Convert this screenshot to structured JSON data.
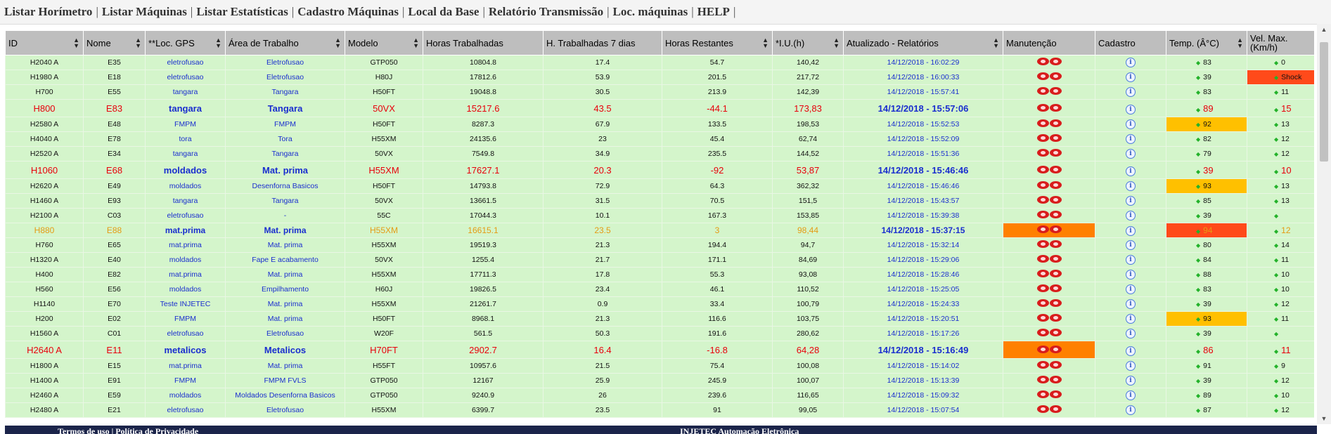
{
  "nav": [
    "Listar Horímetro",
    "Listar Máquinas",
    "Listar Estatísticas",
    "Cadastro Máquinas",
    "Local da Base",
    "Relatório Transmissão",
    "Loc. máquinas",
    "HELP"
  ],
  "columns": [
    "ID",
    "Nome",
    "**Loc. GPS",
    "Área de Trabalho",
    "Modelo",
    "Horas Trabalhadas",
    "H. Trabalhadas 7 dias",
    "Horas Restantes",
    "*I.U.(h)",
    "Atualizado - Relatórios",
    "Manutenção",
    "Cadastro",
    "Temp. (Â°C)",
    "Vel. Max.(Km/h)"
  ],
  "rows": [
    {
      "id": "H2040 A",
      "nome": "E35",
      "gps": "eletrofusao",
      "area": "Eletrofusao",
      "modelo": "GTP050",
      "horas": "10804.8",
      "h7": "17.4",
      "rest": "54.7",
      "iu": "140,42",
      "atual": "14/12/2018 - 16:02:29",
      "temp": "83",
      "vel": "0",
      "style": ""
    },
    {
      "id": "H1980 A",
      "nome": "E18",
      "gps": "eletrofusao",
      "area": "Eletrofusao",
      "modelo": "H80J",
      "horas": "17812.6",
      "h7": "53.9",
      "rest": "201.5",
      "iu": "217,72",
      "atual": "14/12/2018 - 16:00:33",
      "temp": "39",
      "vel": "Shock",
      "style": "",
      "velHl": "red"
    },
    {
      "id": "H700",
      "nome": "E55",
      "gps": "tangara",
      "area": "Tangara",
      "modelo": "H50FT",
      "horas": "19048.8",
      "h7": "30.5",
      "rest": "213.9",
      "iu": "142,39",
      "atual": "14/12/2018 - 15:57:41",
      "temp": "83",
      "vel": "11",
      "style": ""
    },
    {
      "id": "H800",
      "nome": "E83",
      "gps": "tangara",
      "area": "Tangara",
      "modelo": "50VX",
      "horas": "15217.6",
      "h7": "43.5",
      "rest": "-44.1",
      "iu": "173,83",
      "atual": "14/12/2018 - 15:57:06",
      "temp": "89",
      "vel": "15",
      "style": "alert"
    },
    {
      "id": "H2580 A",
      "nome": "E48",
      "gps": "FMPM",
      "area": "FMPM",
      "modelo": "H50FT",
      "horas": "8287.3",
      "h7": "67.9",
      "rest": "133.5",
      "iu": "198,53",
      "atual": "14/12/2018 - 15:52:53",
      "temp": "92",
      "vel": "13",
      "style": "",
      "tempHl": "yellow"
    },
    {
      "id": "H4040 A",
      "nome": "E78",
      "gps": "tora",
      "area": "Tora",
      "modelo": "H55XM",
      "horas": "24135.6",
      "h7": "23",
      "rest": "45.4",
      "iu": "62,74",
      "atual": "14/12/2018 - 15:52:09",
      "temp": "82",
      "vel": "12",
      "style": ""
    },
    {
      "id": "H2520 A",
      "nome": "E34",
      "gps": "tangara",
      "area": "Tangara",
      "modelo": "50VX",
      "horas": "7549.8",
      "h7": "34.9",
      "rest": "235.5",
      "iu": "144,52",
      "atual": "14/12/2018 - 15:51:36",
      "temp": "79",
      "vel": "12",
      "style": ""
    },
    {
      "id": "H1060",
      "nome": "E68",
      "gps": "moldados",
      "area": "Mat. prima",
      "modelo": "H55XM",
      "horas": "17627.1",
      "h7": "20.3",
      "rest": "-92",
      "iu": "53,87",
      "atual": "14/12/2018 - 15:46:46",
      "temp": "39",
      "vel": "10",
      "style": "alert"
    },
    {
      "id": "H2620 A",
      "nome": "E49",
      "gps": "moldados",
      "area": "Desenforna Basicos",
      "modelo": "H50FT",
      "horas": "14793.8",
      "h7": "72.9",
      "rest": "64.3",
      "iu": "362,32",
      "atual": "14/12/2018 - 15:46:46",
      "temp": "93",
      "vel": "13",
      "style": "",
      "tempHl": "yellow"
    },
    {
      "id": "H1460 A",
      "nome": "E93",
      "gps": "tangara",
      "area": "Tangara",
      "modelo": "50VX",
      "horas": "13661.5",
      "h7": "31.5",
      "rest": "70.5",
      "iu": "151,5",
      "atual": "14/12/2018 - 15:43:57",
      "temp": "85",
      "vel": "13",
      "style": ""
    },
    {
      "id": "H2100 A",
      "nome": "C03",
      "gps": "eletrofusao",
      "area": "-",
      "modelo": "55C",
      "horas": "17044.3",
      "h7": "10.1",
      "rest": "167.3",
      "iu": "153,85",
      "atual": "14/12/2018 - 15:39:38",
      "temp": "39",
      "vel": "",
      "style": ""
    },
    {
      "id": "H880",
      "nome": "E88",
      "gps": "mat.prima",
      "area": "Mat. prima",
      "modelo": "H55XM",
      "horas": "16615.1",
      "h7": "23.5",
      "rest": "3",
      "iu": "98,44",
      "atual": "14/12/2018 - 15:37:15",
      "temp": "94",
      "vel": "12",
      "style": "warn",
      "maintHl": "orange",
      "tempHl": "red"
    },
    {
      "id": "H760",
      "nome": "E65",
      "gps": "mat.prima",
      "area": "Mat. prima",
      "modelo": "H55XM",
      "horas": "19519.3",
      "h7": "21.3",
      "rest": "194.4",
      "iu": "94,7",
      "atual": "14/12/2018 - 15:32:14",
      "temp": "80",
      "vel": "14",
      "style": ""
    },
    {
      "id": "H1320 A",
      "nome": "E40",
      "gps": "moldados",
      "area": "Fape E acabamento",
      "modelo": "50VX",
      "horas": "1255.4",
      "h7": "21.7",
      "rest": "171.1",
      "iu": "84,69",
      "atual": "14/12/2018 - 15:29:06",
      "temp": "84",
      "vel": "11",
      "style": ""
    },
    {
      "id": "H400",
      "nome": "E82",
      "gps": "mat.prima",
      "area": "Mat. prima",
      "modelo": "H55XM",
      "horas": "17711.3",
      "h7": "17.8",
      "rest": "55.3",
      "iu": "93,08",
      "atual": "14/12/2018 - 15:28:46",
      "temp": "88",
      "vel": "10",
      "style": ""
    },
    {
      "id": "H560",
      "nome": "E56",
      "gps": "moldados",
      "area": "Empilhamento",
      "modelo": "H60J",
      "horas": "19826.5",
      "h7": "23.4",
      "rest": "46.1",
      "iu": "110,52",
      "atual": "14/12/2018 - 15:25:05",
      "temp": "83",
      "vel": "10",
      "style": ""
    },
    {
      "id": "H1140",
      "nome": "E70",
      "gps": "Teste INJETEC",
      "area": "Mat. prima",
      "modelo": "H55XM",
      "horas": "21261.7",
      "h7": "0.9",
      "rest": "33.4",
      "iu": "100,79",
      "atual": "14/12/2018 - 15:24:33",
      "temp": "39",
      "vel": "12",
      "style": ""
    },
    {
      "id": "H200",
      "nome": "E02",
      "gps": "FMPM",
      "area": "Mat. prima",
      "modelo": "H50FT",
      "horas": "8968.1",
      "h7": "21.3",
      "rest": "116.6",
      "iu": "103,75",
      "atual": "14/12/2018 - 15:20:51",
      "temp": "93",
      "vel": "11",
      "style": "",
      "tempHl": "yellow"
    },
    {
      "id": "H1560 A",
      "nome": "C01",
      "gps": "eletrofusao",
      "area": "Eletrofusao",
      "modelo": "W20F",
      "horas": "561.5",
      "h7": "50.3",
      "rest": "191.6",
      "iu": "280,62",
      "atual": "14/12/2018 - 15:17:26",
      "temp": "39",
      "vel": "",
      "style": ""
    },
    {
      "id": "H2640 A",
      "nome": "E11",
      "gps": "metalicos",
      "area": "Metalicos",
      "modelo": "H70FT",
      "horas": "2902.7",
      "h7": "16.4",
      "rest": "-16.8",
      "iu": "64,28",
      "atual": "14/12/2018 - 15:16:49",
      "temp": "86",
      "vel": "11",
      "style": "alert",
      "maintHl": "orange"
    },
    {
      "id": "H1800 A",
      "nome": "E15",
      "gps": "mat.prima",
      "area": "Mat. prima",
      "modelo": "H55FT",
      "horas": "10957.6",
      "h7": "21.5",
      "rest": "75.4",
      "iu": "100,08",
      "atual": "14/12/2018 - 15:14:02",
      "temp": "91",
      "vel": "9",
      "style": ""
    },
    {
      "id": "H1400 A",
      "nome": "E91",
      "gps": "FMPM",
      "area": "FMPM FVLS",
      "modelo": "GTP050",
      "horas": "12167",
      "h7": "25.9",
      "rest": "245.9",
      "iu": "100,07",
      "atual": "14/12/2018 - 15:13:39",
      "temp": "39",
      "vel": "12",
      "style": ""
    },
    {
      "id": "H2460 A",
      "nome": "E59",
      "gps": "moldados",
      "area": "Moldados Desenforna Basicos",
      "modelo": "GTP050",
      "horas": "9240.9",
      "h7": "26",
      "rest": "239.6",
      "iu": "116,65",
      "atual": "14/12/2018 - 15:09:32",
      "temp": "89",
      "vel": "10",
      "style": ""
    },
    {
      "id": "H2480 A",
      "nome": "E21",
      "gps": "eletrofusao",
      "area": "Eletrofusao",
      "modelo": "H55XM",
      "horas": "6399.7",
      "h7": "23.5",
      "rest": "91",
      "iu": "99,05",
      "atual": "14/12/2018 - 15:07:54",
      "temp": "87",
      "vel": "12",
      "style": ""
    }
  ],
  "footer": {
    "left": "Termos de uso | Política de Privacidade",
    "center": "INJETEC Automação Eletrônica"
  },
  "colors": {
    "row_bg": "#d4f5cb",
    "header_bg": "#bebebe",
    "alert_text": "#e8000b",
    "warn_text": "#e59b14",
    "link_text": "#1a2ecf",
    "orange": "#ff8000",
    "yellow": "#ffc000",
    "red": "#ff4a1a",
    "footer_bg": "#1b244a"
  }
}
